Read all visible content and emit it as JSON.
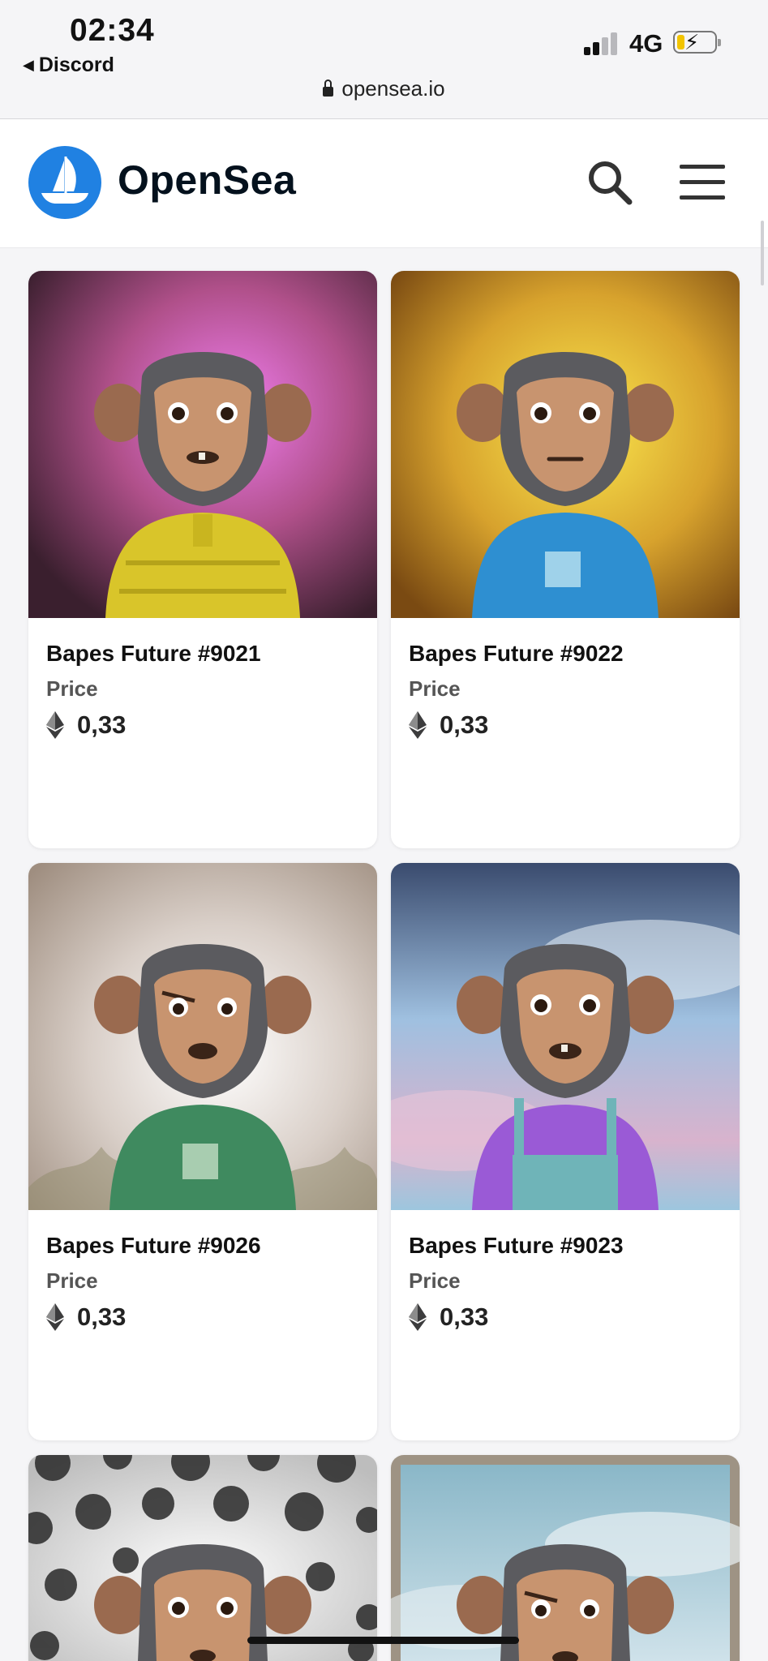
{
  "status": {
    "time": "02:34",
    "back_app": "Discord",
    "network": "4G",
    "url": "opensea.io"
  },
  "header": {
    "brand": "OpenSea",
    "brand_color": "#2081e2"
  },
  "cards": [
    {
      "title": "Bapes Future #9021",
      "price_label": "Price",
      "price": "0,33",
      "bg": "pink-gradient",
      "outfit": "yellow puffer jacket"
    },
    {
      "title": "Bapes Future #9022",
      "price_label": "Price",
      "price": "0,33",
      "bg": "yellow-gradient",
      "outfit": "blue t-shirt"
    },
    {
      "title": "Bapes Future #9026",
      "price_label": "Price",
      "price": "0,33",
      "bg": "beige-floral",
      "outfit": "green t-shirt"
    },
    {
      "title": "Bapes Future #9023",
      "price_label": "Price",
      "price": "0,33",
      "bg": "sky-clouds",
      "outfit": "purple shirt with overalls"
    },
    {
      "title": "",
      "price_label": "",
      "price": "",
      "bg": "polka-dots"
    },
    {
      "title": "",
      "price_label": "",
      "price": "",
      "bg": "pale-sky"
    }
  ],
  "icons": {
    "logo": "opensea-boat-icon",
    "search": "search-icon",
    "menu": "hamburger-menu-icon",
    "currency": "ethereum-icon"
  }
}
